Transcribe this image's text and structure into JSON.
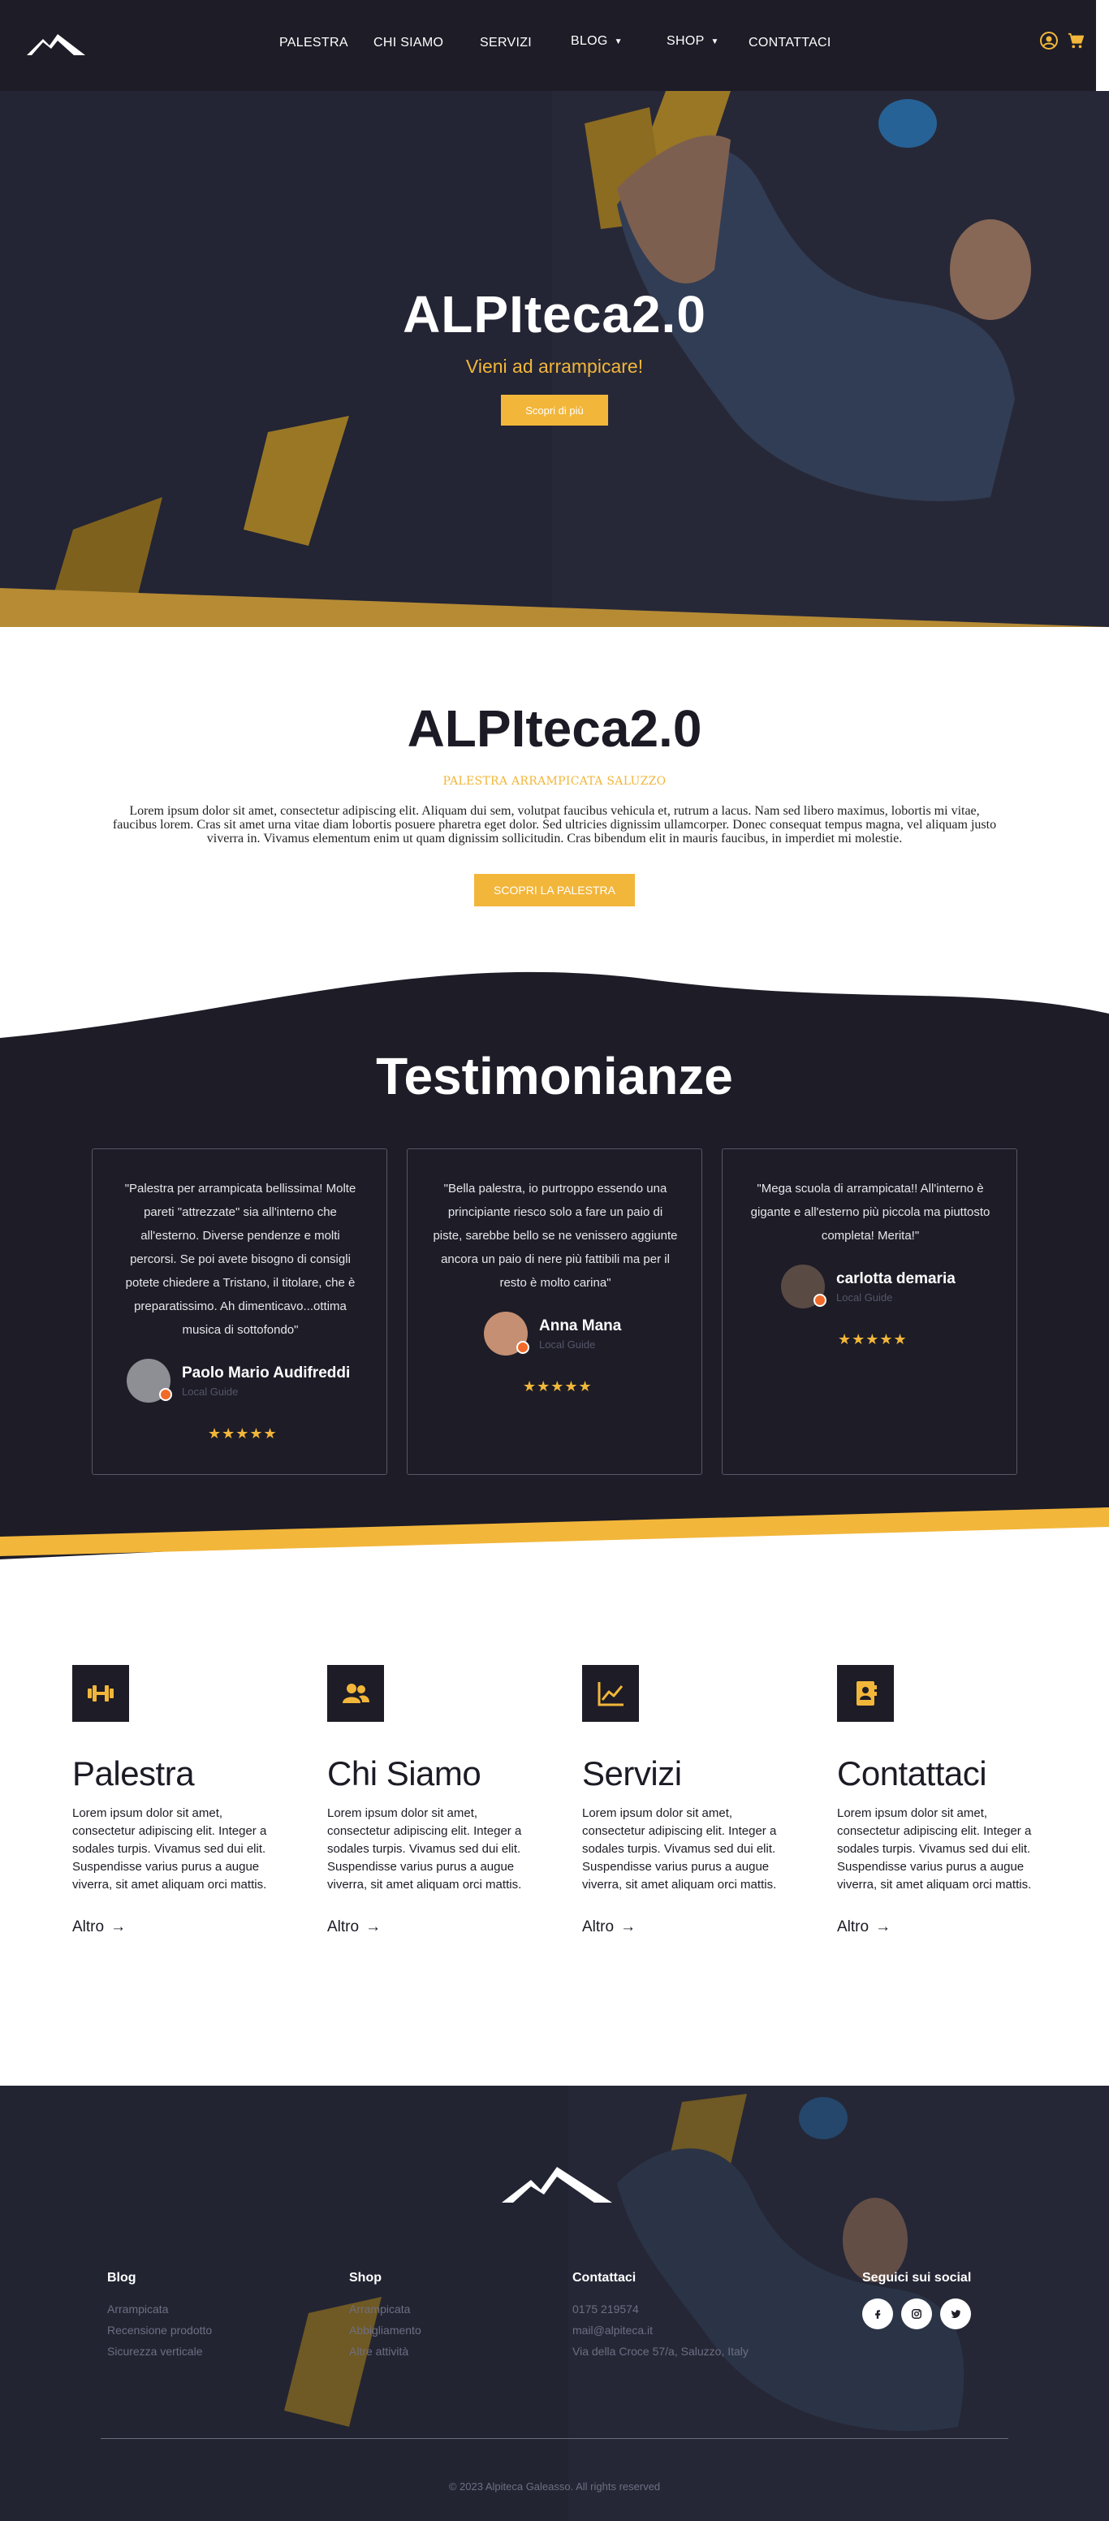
{
  "nav": {
    "items": [
      {
        "label": "PALESTRA",
        "dropdown": false
      },
      {
        "label": "CHI SIAMO",
        "dropdown": false
      },
      {
        "label": "SERVIZI",
        "dropdown": false
      },
      {
        "label": "BLOG",
        "dropdown": true
      },
      {
        "label": "SHOP",
        "dropdown": true
      },
      {
        "label": "CONTATTACI",
        "dropdown": false
      }
    ],
    "icons": [
      "user-icon",
      "cart-icon"
    ]
  },
  "hero": {
    "title": "ALPIteca2.0",
    "subtitle": "Vieni ad arrampicare!",
    "button": "Scopri di più"
  },
  "intro": {
    "title": "ALPIteca2.0",
    "kicker": "PALESTRA ARRAMPICATA SALUZZO",
    "body": "Lorem ipsum dolor sit amet, consectetur adipiscing elit. Aliquam dui sem, volutpat faucibus vehicula et, rutrum a lacus. Nam sed libero maximus, lobortis mi vitae, faucibus lorem. Cras sit amet urna vitae diam lobortis posuere pharetra eget dolor. Sed ultricies dignissim ullamcorper. Donec consequat tempus magna, vel aliquam justo viverra in. Vivamus elementum enim ut quam dignissim sollicitudin. Cras bibendum elit in mauris faucibus, in imperdiet mi molestie.",
    "button": "SCOPRI LA PALESTRA"
  },
  "testimonials": {
    "title": "Testimonianze",
    "items": [
      {
        "quote": "\"Palestra per arrampicata bellissima! Molte pareti \"attrezzate\" sia all'interno che all'esterno. Diverse pendenze e molti percorsi. Se poi avete bisogno di consigli potete chiedere a Tristano, il titolare, che è preparatissimo. Ah dimenticavo...ottima musica di sottofondo\"",
        "name": "Paolo Mario Audifreddi",
        "role": "Local Guide",
        "stars": "★★★★★"
      },
      {
        "quote": "\"Bella palestra, io purtroppo essendo una principiante riesco solo a fare un paio di piste, sarebbe bello se ne venissero aggiunte ancora un paio di nere più fattibili ma per il resto è molto carina\"",
        "name": "Anna Mana",
        "role": "Local Guide",
        "stars": "★★★★★"
      },
      {
        "quote": "\"Mega scuola di arrampicata!! All'interno è gigante e all'esterno più piccola ma piuttosto completa! Merita!\"",
        "name": "carlotta demaria",
        "role": "Local Guide",
        "stars": "★★★★★"
      }
    ]
  },
  "features": [
    {
      "icon": "dumbbell-icon",
      "title": "Palestra",
      "text": "Lorem ipsum dolor sit amet, consectetur adipiscing elit. Integer a sodales turpis. Vivamus sed dui elit. Suspendisse varius purus a augue viverra, sit amet aliquam orci mattis.",
      "link": "Altro"
    },
    {
      "icon": "people-icon",
      "title": "Chi Siamo",
      "text": "Lorem ipsum dolor sit amet, consectetur adipiscing elit. Integer a sodales turpis. Vivamus sed dui elit. Suspendisse varius purus a augue viverra, sit amet aliquam orci mattis.",
      "link": "Altro"
    },
    {
      "icon": "chart-icon",
      "title": "Servizi",
      "text": "Lorem ipsum dolor sit amet, consectetur adipiscing elit. Integer a sodales turpis. Vivamus sed dui elit. Suspendisse varius purus a augue viverra, sit amet aliquam orci mattis.",
      "link": "Altro"
    },
    {
      "icon": "contact-book-icon",
      "title": "Contattaci",
      "text": "Lorem ipsum dolor sit amet, consectetur adipiscing elit. Integer a sodales turpis. Vivamus sed dui elit. Suspendisse varius purus a augue viverra, sit amet aliquam orci mattis.",
      "link": "Altro"
    }
  ],
  "footer": {
    "blog": {
      "title": "Blog",
      "links": [
        "Arrampicata",
        "Recensione prodotto",
        "Sicurezza verticale"
      ]
    },
    "shop": {
      "title": "Shop",
      "links": [
        "Arrampicata",
        "Abbigliamento",
        "Altre attività"
      ]
    },
    "contact": {
      "title": "Contattaci",
      "lines": [
        "0175 219574",
        "mail@alpiteca.it",
        "Via della Croce 57/a, Saluzzo, Italy"
      ]
    },
    "social": {
      "title": "Seguici sui social",
      "icons": [
        "facebook-icon",
        "instagram-icon",
        "twitter-icon"
      ]
    },
    "copyright": "© 2023 Alpiteca Galeasso. All rights reserved"
  },
  "colors": {
    "dark": "#1d1c27",
    "accent": "#f2b63a",
    "white": "#ffffff"
  }
}
